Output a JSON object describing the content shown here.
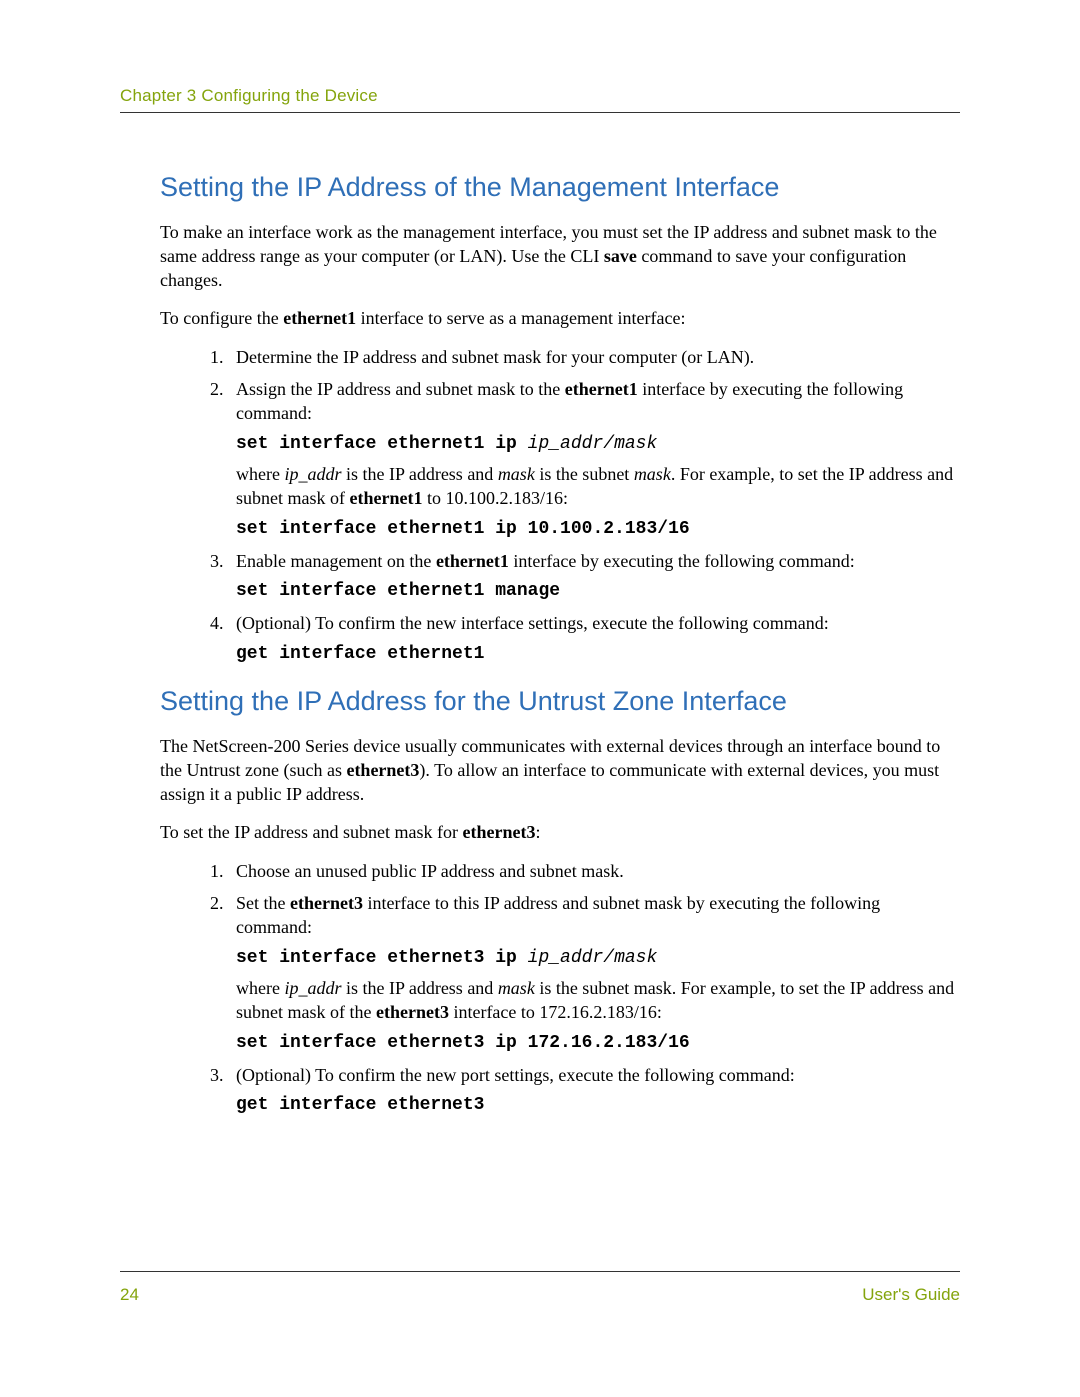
{
  "header": {
    "chapter": "Chapter 3 Configuring the Device"
  },
  "section1": {
    "title": "Setting the IP Address of the Management Interface",
    "p1_a": "To make an interface work as the management interface, you must set the IP address and subnet mask to the same address range as your computer (or LAN). Use the CLI ",
    "p1_b": "save",
    "p1_c": " command to save your configuration changes.",
    "p2_a": "To configure the ",
    "p2_b": "ethernet1",
    "p2_c": " interface to serve as a management interface:",
    "step1": "Determine the IP address and subnet mask for your computer (or LAN).",
    "step2_a": "Assign the IP address and subnet mask to the ",
    "step2_b": "ethernet1",
    "step2_c": " interface by executing the following command:",
    "step2_code1_a": "set interface ethernet1 ip ",
    "step2_code1_b": "ip_addr/mask",
    "step2_p_a": "where ",
    "step2_p_b": "ip_addr",
    "step2_p_c": " is the IP address and ",
    "step2_p_d": "mask",
    "step2_p_e": " is the subnet ",
    "step2_p_f": "mask",
    "step2_p_g": ". For example, to set the IP address and subnet mask of ",
    "step2_p_h": "ethernet1",
    "step2_p_i": " to 10.100.2.183/16:",
    "step2_code2": "set interface ethernet1 ip 10.100.2.183/16",
    "step3_a": "Enable management on the ",
    "step3_b": "ethernet1",
    "step3_c": " interface by executing the following command:",
    "step3_code": "set interface ethernet1 manage",
    "step4": "(Optional) To confirm the new interface settings, execute the following command:",
    "step4_code": "get interface ethernet1"
  },
  "section2": {
    "title": "Setting the IP Address for the Untrust Zone Interface",
    "p1_a": "The NetScreen-200 Series device usually communicates with external devices through an interface bound to the Untrust zone (such as ",
    "p1_b": "ethernet3",
    "p1_c": "). To allow an interface to communicate with external devices, you must assign it a public IP address.",
    "p2_a": "To set the IP address and subnet mask for ",
    "p2_b": "ethernet3",
    "p2_c": ":",
    "step1": "Choose an unused public IP address and subnet mask.",
    "step2_a": "Set the ",
    "step2_b": "ethernet3",
    "step2_c": " interface to this IP address and subnet mask by executing the following command:",
    "step2_code1_a": "set interface ethernet3 ip ",
    "step2_code1_b": "ip_addr/mask",
    "step2_p_a": "where ",
    "step2_p_b": "ip_addr",
    "step2_p_c": " is the IP address and ",
    "step2_p_d": "mask",
    "step2_p_e": " is the subnet mask. For example, to set the IP address and subnet mask of the ",
    "step2_p_f": "ethernet3",
    "step2_p_g": " interface to 172.16.2.183/16:",
    "step2_code2": "set interface ethernet3 ip 172.16.2.183/16",
    "step3": "(Optional) To confirm the new port settings, execute the following command:",
    "step3_code": "get interface ethernet3"
  },
  "footer": {
    "page": "24",
    "guide": "User's Guide"
  }
}
